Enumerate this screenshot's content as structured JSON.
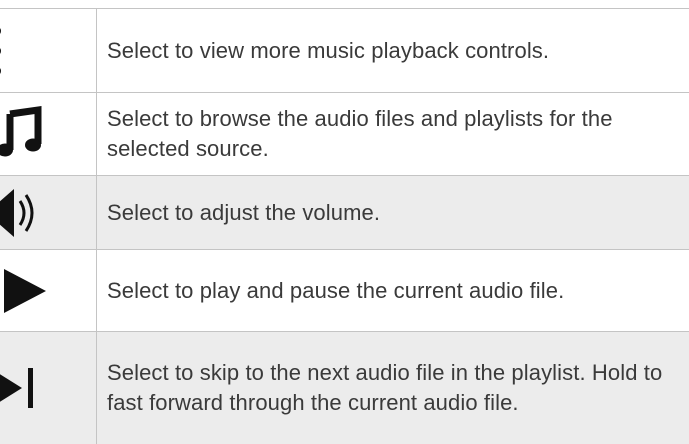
{
  "rows": [
    {
      "icon": "more-vertical-icon",
      "text": "Select to view more music playback controls."
    },
    {
      "icon": "music-note-icon",
      "text": "Select to browse the audio files and playlists for the selected source."
    },
    {
      "icon": "volume-icon",
      "text": "Select to adjust the volume."
    },
    {
      "icon": "play-icon",
      "text": "Select to play and pause the current audio file."
    },
    {
      "icon": "skip-next-icon",
      "text": "Select to skip to the next audio file in the playlist. Hold to fast forward through the current audio file."
    }
  ],
  "colors": {
    "shade": "#ececec",
    "border": "#c4c4c4",
    "text": "#3a3a3a",
    "icon": "#111111"
  }
}
